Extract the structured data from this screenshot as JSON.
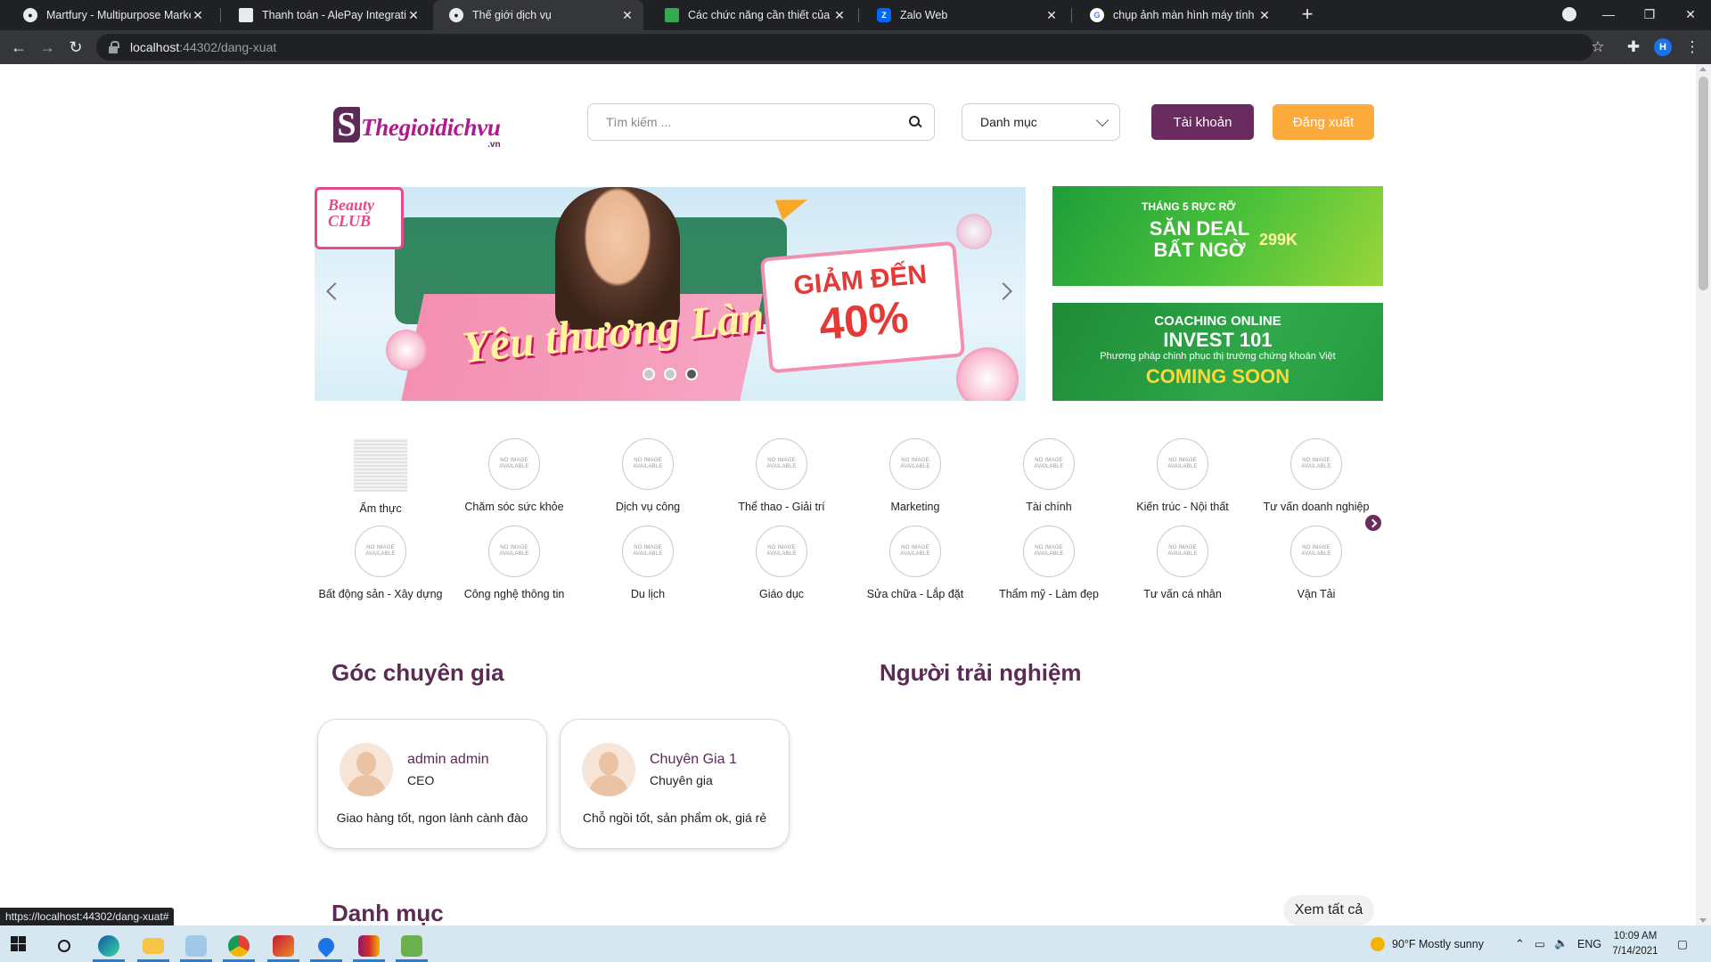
{
  "browser": {
    "tabs": [
      {
        "title": "Martfury - Multipurpose Marketp",
        "active": false,
        "favicon": "globe-icon"
      },
      {
        "title": "Thanh toán - AlePay Integration",
        "active": false,
        "favicon": "document-icon"
      },
      {
        "title": "Thế giới dịch vụ",
        "active": true,
        "favicon": "globe-icon"
      },
      {
        "title": "Các chức năng cần thiết của web",
        "active": false,
        "favicon": "leaf-icon"
      },
      {
        "title": "Zalo Web",
        "active": false,
        "favicon": "zalo-icon"
      },
      {
        "title": "chụp ảnh màn hình máy tính - Tì",
        "active": false,
        "favicon": "google-icon"
      }
    ],
    "url_host": "localhost",
    "url_path": ":44302/dang-xuat",
    "profile_initial": "H",
    "status_url": "https://localhost:44302/dang-xuat#"
  },
  "header": {
    "logo_text": "Thegioidichvu",
    "logo_suffix": ".vn",
    "search_placeholder": "Tìm kiếm ...",
    "category_select": "Danh mục",
    "account_button": "Tài khoản",
    "logout_button": "Đăng xuất"
  },
  "banners": {
    "main": {
      "badge": "Beauty CLUB",
      "slogan": "Yêu thương Làn da",
      "promo_line1": "GIẢM ĐẾN",
      "promo_line2": "40%",
      "dots": 3,
      "active_dot": 2
    },
    "side1": {
      "line1": "THÁNG 5 RỰC RỠ",
      "line2": "SĂN DEAL BẤT NGỜ",
      "price": "299K"
    },
    "side2": {
      "line1": "COACHING ONLINE",
      "line2": "INVEST 101",
      "line3": "Phương pháp chinh phục thị trường chứng khoán Việt",
      "line4": "COMING SOON"
    }
  },
  "categories": {
    "no_image_text": "NO IMAGE AVAILABLE",
    "items": [
      "Ẩm thực",
      "Chăm sóc sức khỏe",
      "Dịch vụ công",
      "Thể thao - Giải trí",
      "Marketing",
      "Tài chính",
      "Kiến trúc - Nội thất",
      "Tư vấn doanh nghiệp",
      "Bất động sản - Xây dựng",
      "Công nghệ thông tin",
      "Du lịch",
      "Giáo dục",
      "Sửa chữa - Lắp đặt",
      "Thẩm mỹ - Làm đẹp",
      "Tư vấn cá nhân",
      "Vận Tải"
    ]
  },
  "experts": {
    "title": "Góc chuyên gia",
    "cards": [
      {
        "name": "admin admin",
        "role": "CEO",
        "quote": "Giao hàng tốt, ngon lành cành đào"
      },
      {
        "name": "Chuyên Gia 1",
        "role": "Chuyên gia",
        "quote": "Chỗ ngồi tốt, sản phẩm ok, giá rẻ"
      }
    ]
  },
  "experiencers": {
    "title": "Người trải nghiệm"
  },
  "category_section": {
    "title": "Danh mục",
    "see_all": "Xem tất cả"
  },
  "taskbar": {
    "weather": "90°F  Mostly sunny",
    "language": "ENG",
    "time": "10:09 AM",
    "date": "7/14/2021"
  }
}
